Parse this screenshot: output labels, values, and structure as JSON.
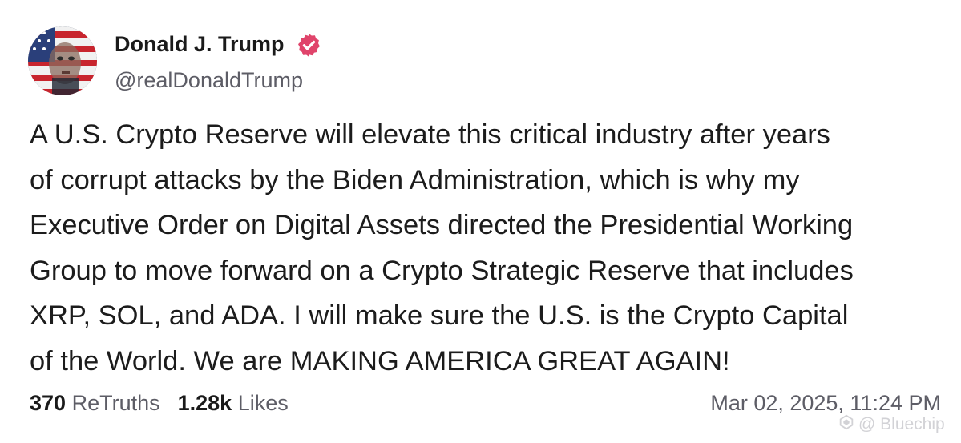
{
  "post": {
    "author": {
      "display_name": "Donald J. Trump",
      "handle": "@realDonaldTrump",
      "verified": true
    },
    "lines": [
      "A U.S. Crypto Reserve will elevate this critical industry after years",
      "of corrupt attacks by the Biden Administration, which is why my",
      "Executive Order on Digital Assets directed the Presidential Working",
      "Group to move forward on a Crypto Strategic Reserve that includes",
      "XRP, SOL, and ADA. I will make sure the U.S. is the Crypto Capital",
      "of the World. We are MAKING AMERICA GREAT AGAIN!"
    ],
    "stats": {
      "retruths_count": "370",
      "retruths_label": "ReTruths",
      "likes_count": "1.28k",
      "likes_label": "Likes"
    },
    "timestamp": "Mar 02, 2025, 11:24 PM"
  },
  "watermark": {
    "text": "@ Bluechip"
  },
  "colors": {
    "verified_badge": "#e0446b",
    "text_primary": "#1c1c1c",
    "text_secondary": "#5d5d66"
  }
}
